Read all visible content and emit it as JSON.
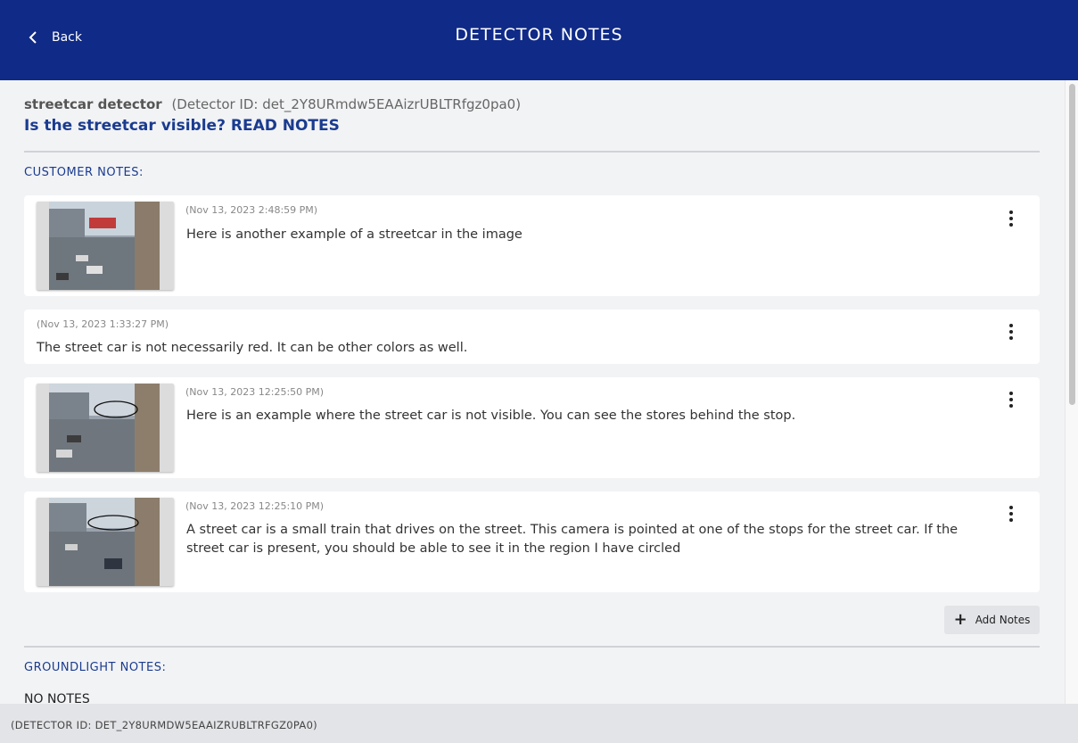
{
  "header": {
    "back_label": "Back",
    "title": "DETECTOR NOTES",
    "background": "#0f2a87"
  },
  "detector": {
    "name": "streetcar detector",
    "id_text": "(Detector ID: det_2Y8URmdw5EAAizrUBLTRfgz0pa0)",
    "question": "Is the streetcar visible? READ NOTES"
  },
  "customer_notes": {
    "label": "CUSTOMER NOTES:",
    "notes": [
      {
        "timestamp": "(Nov 13, 2023 2:48:59 PM)",
        "text": "Here is another example of a streetcar in the image",
        "has_image": true,
        "circled": false
      },
      {
        "timestamp": "(Nov 13, 2023 1:33:27 PM)",
        "text": "The street car is not necessarily red. It can be other colors as well.",
        "has_image": false
      },
      {
        "timestamp": "(Nov 13, 2023 12:25:50 PM)",
        "text": "Here is an example where the street car is not visible. You can see the stores behind the stop.",
        "has_image": true,
        "circled": true
      },
      {
        "timestamp": "(Nov 13, 2023 12:25:10 PM)",
        "text": "A street car is a small train that drives on the street. This camera is pointed at one of the stops for the street car. If the street car is present, you should be able to see it in the region I have circled",
        "has_image": true,
        "circled": true
      }
    ],
    "add_button_label": "Add Notes"
  },
  "groundlight_notes": {
    "label": "GROUNDLIGHT NOTES:",
    "empty_text": "NO NOTES"
  },
  "footer": {
    "text": "(DETECTOR ID: DET_2Y8URMDW5EAAIZRUBLTRFGZ0PA0)"
  },
  "icons": {
    "back": "chevron-left-icon",
    "menu": "more-vertical-icon",
    "add": "plus-icon"
  },
  "colors": {
    "accent": "#1a3b8f",
    "card": "#ffffff",
    "page": "#f2f3f5"
  }
}
